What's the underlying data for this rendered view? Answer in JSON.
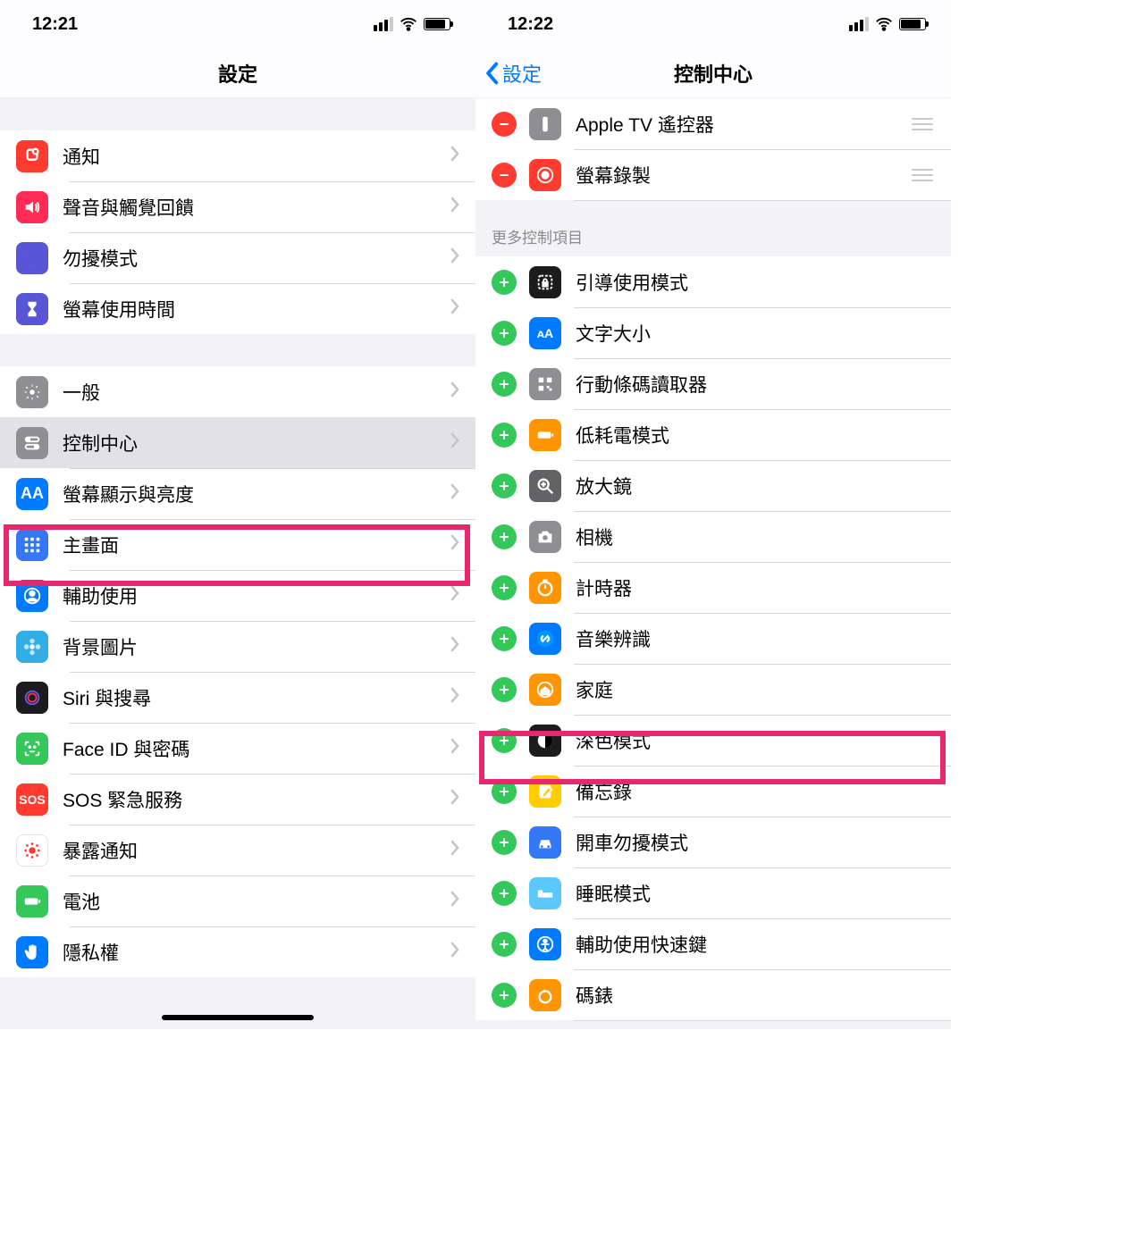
{
  "left": {
    "time": "12:21",
    "title": "設定",
    "group1": [
      {
        "label": "通知",
        "icon": "bell"
      },
      {
        "label": "聲音與觸覺回饋",
        "icon": "sound"
      },
      {
        "label": "勿擾模式",
        "icon": "moon"
      },
      {
        "label": "螢幕使用時間",
        "icon": "hourglass"
      }
    ],
    "group2": [
      {
        "label": "一般",
        "icon": "gear"
      },
      {
        "label": "控制中心",
        "icon": "switches",
        "highlight": true
      },
      {
        "label": "螢幕顯示與亮度",
        "icon": "aa"
      },
      {
        "label": "主畫面",
        "icon": "grid"
      },
      {
        "label": "輔助使用",
        "icon": "person"
      },
      {
        "label": "背景圖片",
        "icon": "flower"
      },
      {
        "label": "Siri 與搜尋",
        "icon": "siri"
      },
      {
        "label": "Face ID 與密碼",
        "icon": "faceid"
      },
      {
        "label": "SOS 緊急服務",
        "icon": "sos"
      },
      {
        "label": "暴露通知",
        "icon": "exposure"
      },
      {
        "label": "電池",
        "icon": "battery"
      },
      {
        "label": "隱私權",
        "icon": "hand"
      }
    ]
  },
  "right": {
    "time": "12:22",
    "back": "設定",
    "title": "控制中心",
    "included": [
      {
        "label": "Apple TV 遙控器",
        "icon": "remote"
      },
      {
        "label": "螢幕錄製",
        "icon": "record"
      }
    ],
    "more_header": "更多控制項目",
    "more": [
      {
        "label": "引導使用模式",
        "icon": "lock"
      },
      {
        "label": "文字大小",
        "icon": "textsize"
      },
      {
        "label": "行動條碼讀取器",
        "icon": "qr"
      },
      {
        "label": "低耗電模式",
        "icon": "lowpower"
      },
      {
        "label": "放大鏡",
        "icon": "magnifier"
      },
      {
        "label": "相機",
        "icon": "camera"
      },
      {
        "label": "計時器",
        "icon": "timer"
      },
      {
        "label": "音樂辨識",
        "icon": "shazam",
        "highlight": true
      },
      {
        "label": "家庭",
        "icon": "home"
      },
      {
        "label": "深色模式",
        "icon": "darkmode"
      },
      {
        "label": "備忘錄",
        "icon": "notes"
      },
      {
        "label": "開車勿擾模式",
        "icon": "car"
      },
      {
        "label": "睡眠模式",
        "icon": "bed"
      },
      {
        "label": "輔助使用快速鍵",
        "icon": "access"
      },
      {
        "label": "碼錶",
        "icon": "stopwatch"
      }
    ]
  }
}
